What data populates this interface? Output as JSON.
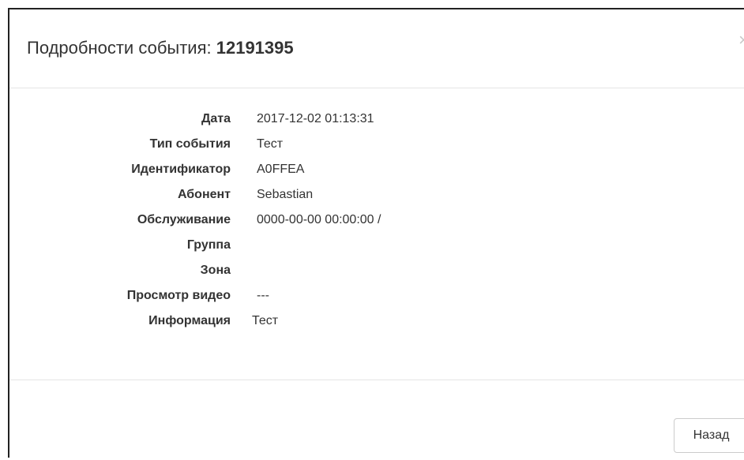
{
  "modal": {
    "title_prefix": "Подробности события: ",
    "event_id": "12191395",
    "close_glyph": "×"
  },
  "details": [
    {
      "label": "Дата",
      "value": "2017-12-02 01:13:31"
    },
    {
      "label": "Тип события",
      "value": "Тест"
    },
    {
      "label": "Идентификатор",
      "value": "A0FFEA"
    },
    {
      "label": "Абонент",
      "value": "Sebastian"
    },
    {
      "label": "Обслуживание",
      "value": "0000-00-00 00:00:00 /"
    },
    {
      "label": "Группа",
      "value": ""
    },
    {
      "label": "Зона",
      "value": ""
    },
    {
      "label": "Просмотр видео",
      "value": "---"
    },
    {
      "label": "Информация",
      "value": "Тест"
    }
  ],
  "footer": {
    "back_label": "Назад"
  }
}
